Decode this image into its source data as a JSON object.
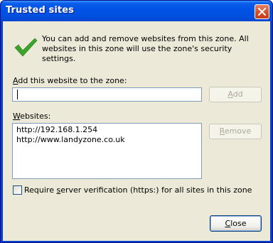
{
  "window": {
    "title": "Trusted sites"
  },
  "info": {
    "icon": "checkmark-icon",
    "text": "You can add and remove websites from this zone. All websites in this zone will use the zone's security settings."
  },
  "add": {
    "label_accel": "A",
    "label_rest": "dd this website to the zone:",
    "input_value": "",
    "button_accel": "A",
    "button_rest": "dd"
  },
  "websites": {
    "label_accel": "W",
    "label_rest": "ebsites:",
    "items": [
      "http://192.168.1.254",
      "http://www.landyzone.co.uk"
    ],
    "remove_accel": "R",
    "remove_rest": "emove"
  },
  "verification": {
    "checked": false,
    "label_before": "Require ",
    "label_accel": "s",
    "label_after": "erver verification (https:) for all sites in this zone"
  },
  "footer": {
    "close_accel": "C",
    "close_rest": "lose"
  },
  "colors": {
    "titlebar": "#0053e6",
    "dialog_bg": "#ece9d8",
    "check_green": "#3aa52a",
    "disabled_text": "#aca899"
  }
}
